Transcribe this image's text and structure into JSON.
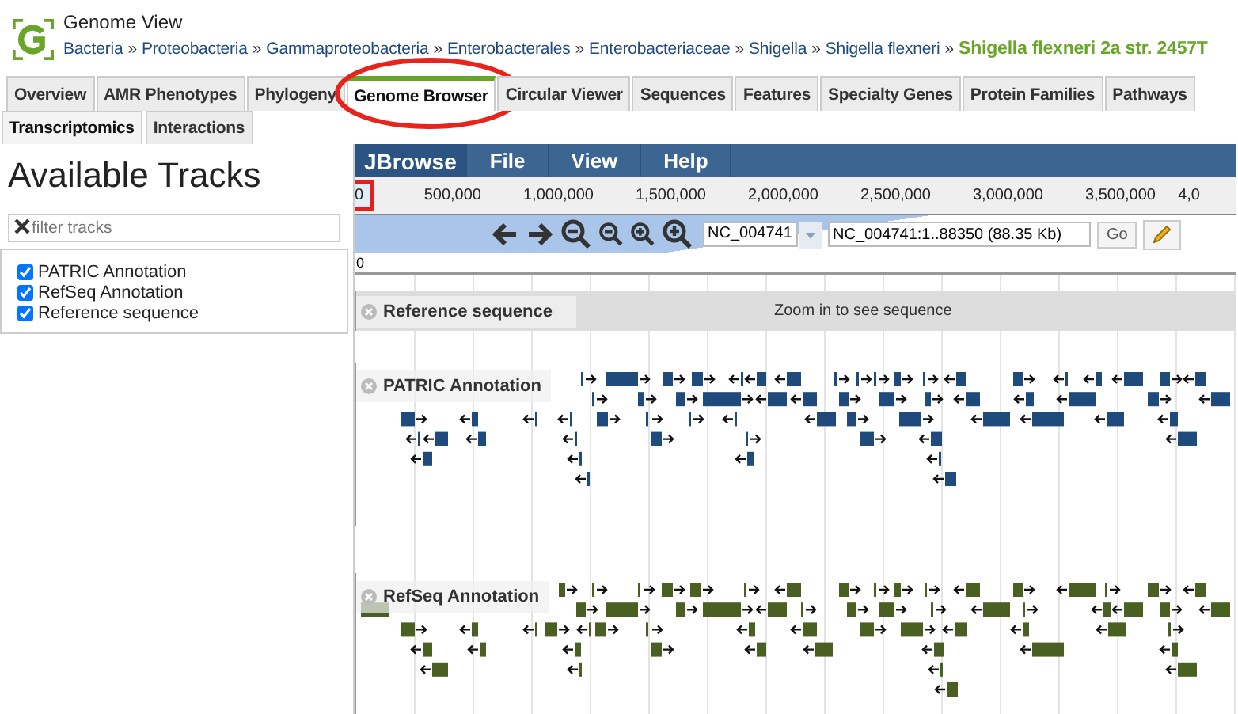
{
  "header": {
    "title": "Genome View",
    "separator": "»",
    "breadcrumbs": [
      "Bacteria",
      "Proteobacteria",
      "Gammaproteobacteria",
      "Enterobacterales",
      "Enterobacteriaceae",
      "Shigella",
      "Shigella flexneri"
    ],
    "current": "Shigella flexneri 2a str. 2457T"
  },
  "tabs": [
    {
      "label": "Overview",
      "selected": false,
      "circled": false
    },
    {
      "label": "AMR Phenotypes",
      "selected": false,
      "circled": false
    },
    {
      "label": "Phylogeny",
      "selected": false,
      "circled": false
    },
    {
      "label": "Genome Browser",
      "selected": true,
      "circled": true
    },
    {
      "label": "Circular Viewer",
      "selected": false,
      "circled": false
    },
    {
      "label": "Sequences",
      "selected": false,
      "circled": false
    },
    {
      "label": "Features",
      "selected": false,
      "circled": false
    },
    {
      "label": "Specialty Genes",
      "selected": false,
      "circled": false
    },
    {
      "label": "Protein Families",
      "selected": false,
      "circled": false
    },
    {
      "label": "Pathways",
      "selected": false,
      "circled": false
    }
  ],
  "subtabs": [
    {
      "label": "Transcriptomics",
      "selected": true
    },
    {
      "label": "Interactions",
      "selected": false
    }
  ],
  "track_panel": {
    "title": "Available Tracks",
    "filter_placeholder": "filter tracks",
    "tracks": [
      {
        "label": "PATRIC Annotation",
        "checked": true
      },
      {
        "label": "RefSeq Annotation",
        "checked": true
      },
      {
        "label": "Reference sequence",
        "checked": true
      }
    ]
  },
  "browser": {
    "menu": [
      "JBrowse",
      "File",
      "View",
      "Help"
    ],
    "ruler": [
      "0",
      "500,000",
      "1,000,000",
      "1,500,000",
      "2,000,000",
      "2,500,000",
      "3,000,000",
      "3,500,000",
      "4,0"
    ],
    "reference_select": "NC_004741",
    "location": "NC_004741:1..88350 (88.35 Kb)",
    "go": "Go",
    "scale_label": "0",
    "tracks": [
      {
        "label": "Reference sequence",
        "kind": "sequence",
        "message": "Zoom in to see sequence"
      },
      {
        "label": "PATRIC Annotation",
        "kind": "features",
        "color": "#1f4a7c"
      },
      {
        "label": "RefSeq Annotation",
        "kind": "features",
        "color": "#4a5f22"
      }
    ]
  }
}
